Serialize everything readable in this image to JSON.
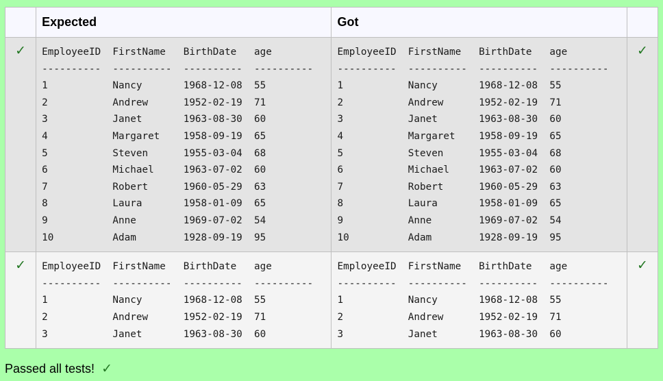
{
  "table": {
    "header": {
      "expected_label": "Expected",
      "got_label": "Got"
    },
    "rows": [
      {
        "status_left": "✓",
        "status_right": "✓",
        "expected": "EmployeeID  FirstName   BirthDate   age\n----------  ----------  ----------  ----------\n1           Nancy       1968-12-08  55\n2           Andrew      1952-02-19  71\n3           Janet       1963-08-30  60\n4           Margaret    1958-09-19  65\n5           Steven      1955-03-04  68\n6           Michael     1963-07-02  60\n7           Robert      1960-05-29  63\n8           Laura       1958-01-09  65\n9           Anne        1969-07-02  54\n10          Adam        1928-09-19  95",
        "got": "EmployeeID  FirstName   BirthDate   age\n----------  ----------  ----------  ----------\n1           Nancy       1968-12-08  55\n2           Andrew      1952-02-19  71\n3           Janet       1963-08-30  60\n4           Margaret    1958-09-19  65\n5           Steven      1955-03-04  68\n6           Michael     1963-07-02  60\n7           Robert      1960-05-29  63\n8           Laura       1958-01-09  65\n9           Anne        1969-07-02  54\n10          Adam        1928-09-19  95"
      },
      {
        "status_left": "✓",
        "status_right": "✓",
        "expected": "EmployeeID  FirstName   BirthDate   age\n----------  ----------  ----------  ----------\n1           Nancy       1968-12-08  55\n2           Andrew      1952-02-19  71\n3           Janet       1963-08-30  60",
        "got": "EmployeeID  FirstName   BirthDate   age\n----------  ----------  ----------  ----------\n1           Nancy       1968-12-08  55\n2           Andrew      1952-02-19  71\n3           Janet       1963-08-30  60"
      }
    ]
  },
  "summary": {
    "text": "Passed all tests!",
    "icon": "check-icon",
    "icon_glyph": "✓"
  },
  "colors": {
    "page_background": "#aaffaa",
    "header_background": "#f8f8ff",
    "row_odd_background": "#e4e4e4",
    "row_even_background": "#f4f4f4",
    "check_color": "#227722"
  }
}
